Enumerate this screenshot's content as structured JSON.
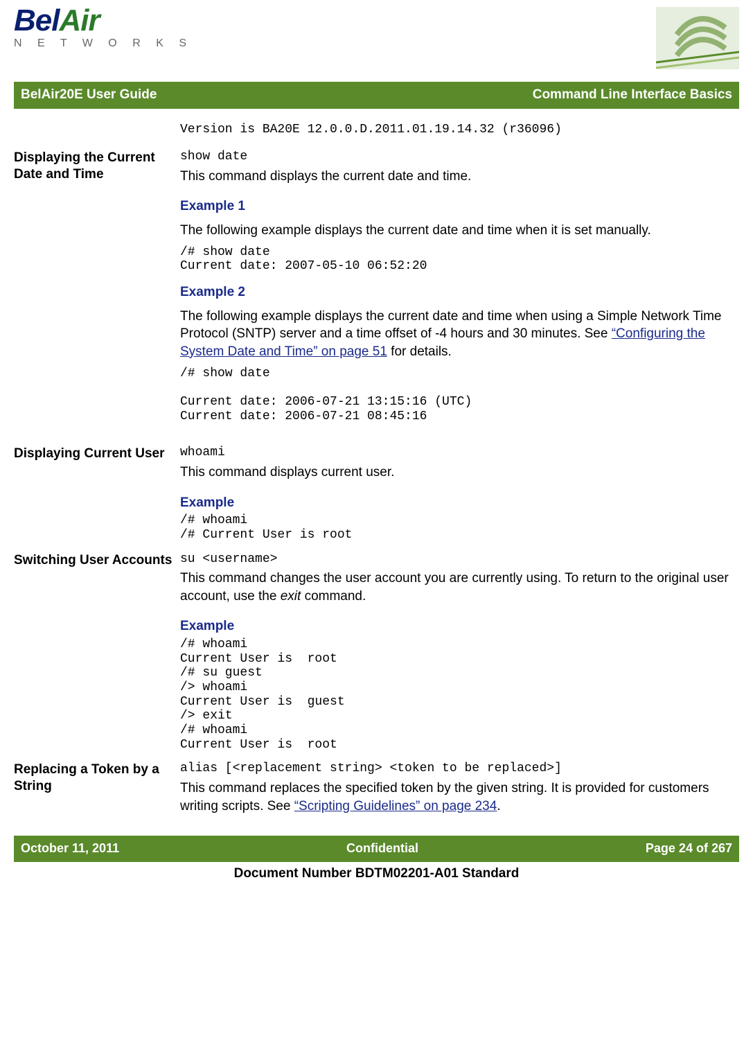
{
  "logo": {
    "brand1": "Bel",
    "brand2": "Air",
    "sub": "N E T W O R K S"
  },
  "header": {
    "left": "BelAir20E User Guide",
    "right": "Command Line Interface Basics"
  },
  "version_line": "Version is BA20E 12.0.0.D.2011.01.19.14.32 (r36096)",
  "sections": {
    "date_time": {
      "title": "Displaying the Current Date and Time",
      "cmd": "show date",
      "desc": "This command displays the current date and time.",
      "ex1_h": "Example 1",
      "ex1_desc": "The following example displays the current date and time when it is set manually.",
      "ex1_code": "/# show date\nCurrent date: 2007-05-10 06:52:20",
      "ex2_h": "Example 2",
      "ex2_desc_pre": "The following example displays the current date and time when using a Simple Network Time Protocol (SNTP) server and a time offset of -4 hours and 30 minutes. See ",
      "ex2_link": "“Configuring the System Date and Time” on page 51",
      "ex2_desc_post": " for details.",
      "ex2_code": "/# show date\n\nCurrent date: 2006-07-21 13:15:16 (UTC)\nCurrent date: 2006-07-21 08:45:16"
    },
    "current_user": {
      "title": "Displaying Current User",
      "cmd": "whoami",
      "desc": "This command displays current user.",
      "ex_h": "Example",
      "ex_code": "/# whoami\n/# Current User is root"
    },
    "switching": {
      "title": "Switching User Accounts",
      "cmd": "su <username>",
      "desc_pre": "This command changes the user account you are currently using. To return to the original user account, use the ",
      "desc_italic": "exit",
      "desc_post": " command.",
      "ex_h": "Example",
      "ex_code": "/# whoami\nCurrent User is  root\n/# su guest\n/> whoami\nCurrent User is  guest\n/> exit\n/# whoami\nCurrent User is  root"
    },
    "alias": {
      "title": "Replacing a Token by a String",
      "cmd": "alias [<replacement string> <token to be replaced>]",
      "desc_pre": "This command replaces the specified token by the given string. It is provided for customers writing scripts. See ",
      "desc_link": "“Scripting Guidelines” on page 234",
      "desc_post": "."
    }
  },
  "footer": {
    "left": "October 11, 2011",
    "center": "Confidential",
    "right": "Page 24 of 267"
  },
  "doc_num": "Document Number BDTM02201-A01 Standard"
}
